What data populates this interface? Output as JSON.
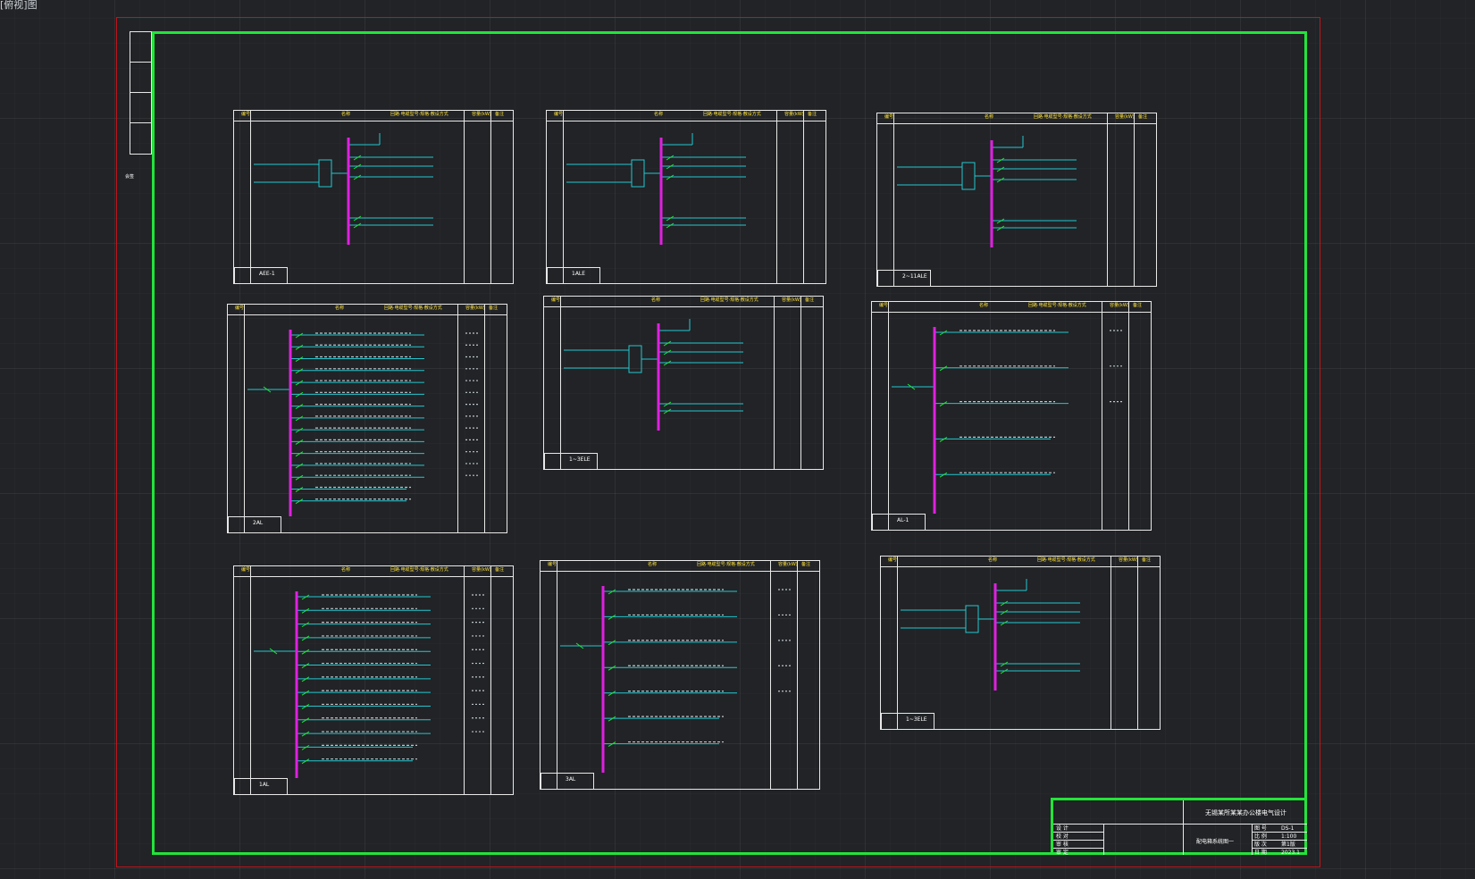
{
  "viewport": {
    "label": "[俯视]图",
    "background": "#212326"
  },
  "colors": {
    "frame": "#22e43a",
    "limits": "#c0141b",
    "busbar": "#e020e0",
    "circuits": "#22c7d0",
    "labels": "#ffe33a",
    "lines": "#e8e8e8"
  },
  "binding_label": "会签",
  "panels": [
    {
      "name": "AEE-1",
      "type": "dual",
      "header": [
        "编号",
        "名称",
        "回路·电缆型号·规格·敷设方式",
        "容量(kW)",
        "备注"
      ]
    },
    {
      "name": "1ALE",
      "type": "dual",
      "header": [
        "编号",
        "名称",
        "回路·电缆型号·规格·敷设方式",
        "容量(kW)",
        "备注"
      ]
    },
    {
      "name": "2~11ALE",
      "type": "dual",
      "header": [
        "编号",
        "名称",
        "回路·电缆型号·规格·敷设方式",
        "容量(kW)",
        "备注"
      ]
    },
    {
      "name": "2AL",
      "type": "multi",
      "header": [
        "编号",
        "名称",
        "回路·电缆型号·规格·敷设方式",
        "容量(kW)",
        "备注"
      ]
    },
    {
      "name": "1~3ELE",
      "type": "dual",
      "header": [
        "编号",
        "名称",
        "回路·电缆型号·规格·敷设方式",
        "容量(kW)",
        "备注"
      ]
    },
    {
      "name": "AL-1",
      "type": "single",
      "header": [
        "编号",
        "名称",
        "回路·电缆型号·规格·敷设方式",
        "容量(kW)",
        "备注"
      ]
    },
    {
      "name": "1AL",
      "type": "multi",
      "header": [
        "编号",
        "名称",
        "回路·电缆型号·规格·敷设方式",
        "容量(kW)",
        "备注"
      ]
    },
    {
      "name": "3AL",
      "type": "single",
      "header": [
        "编号",
        "名称",
        "回路·电缆型号·规格·敷设方式",
        "容量(kW)",
        "备注"
      ]
    },
    {
      "name": "1~3ELE",
      "type": "dual",
      "header": [
        "编号",
        "名称",
        "回路·电缆型号·规格·敷设方式",
        "容量(kW)",
        "备注"
      ]
    }
  ],
  "title_block": {
    "project": "无锡某所某某办公楼电气设计",
    "drawing": "配电箱系统图一",
    "rows": [
      "设 计",
      "校 对",
      "审 核",
      "审 定"
    ],
    "fields": [
      "图 号",
      "比 例",
      "版 次",
      "日 期"
    ],
    "values": [
      "DS-1",
      "1:100",
      "第1版",
      "2023.1"
    ]
  }
}
